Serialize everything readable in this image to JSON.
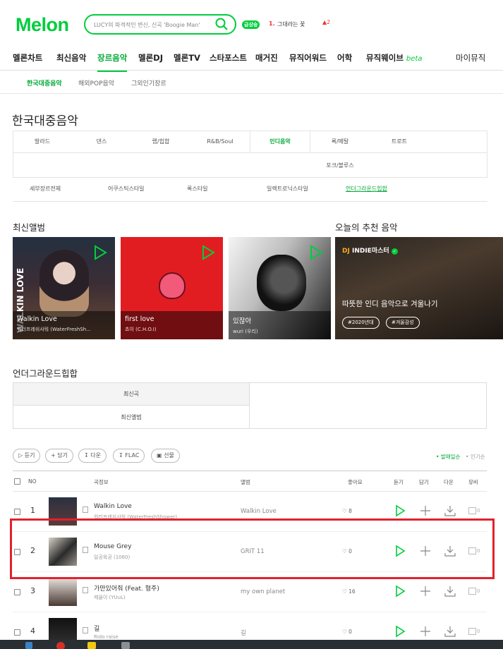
{
  "header": {
    "logo": "Melon",
    "search_placeholder": "LUCY의 파격적인 변신, 신곡 'Boogie Man'",
    "realtime": {
      "badge": "급상승",
      "rank": "1.",
      "title": "그대라는 꽃",
      "change": "2"
    }
  },
  "gnb": [
    {
      "label": "멜론차트"
    },
    {
      "label": "최신음악"
    },
    {
      "label": "장르음악"
    },
    {
      "label": "멜론DJ"
    },
    {
      "label": "멜론TV"
    },
    {
      "label": "스타포스트"
    },
    {
      "label": "매거진"
    },
    {
      "label": "뮤직어워드"
    },
    {
      "label": "어학"
    },
    {
      "label": "뮤직웨이브",
      "badge": "beta"
    },
    {
      "label": "마이뮤직"
    }
  ],
  "subnav": [
    {
      "label": "한국대중음악"
    },
    {
      "label": "해외POP음악"
    },
    {
      "label": "그외인기장르"
    }
  ],
  "page_title": "한국대중음악",
  "genre_tabs": [
    {
      "label": "발라드"
    },
    {
      "label": "댄스"
    },
    {
      "label": "랩/힙합"
    },
    {
      "label": "R&B/Soul"
    },
    {
      "label": "인디음악"
    },
    {
      "label": "록/메탈"
    },
    {
      "label": "트로트"
    },
    {
      "label": "포크/블루스"
    }
  ],
  "sub_genres": [
    {
      "label": "세부장르전체"
    },
    {
      "label": "어쿠스틱스타일"
    },
    {
      "label": "록스타일"
    },
    {
      "label": "일렉트로닉스타일"
    },
    {
      "label": "언더그라운드힙합"
    }
  ],
  "latest_albums_title": "최신앨범",
  "albums": [
    {
      "title": "Walkin Love",
      "artist": "워터프레쉬샤워 (WaterFreshSh...",
      "cover_text": "WALKIN LOVE"
    },
    {
      "title": "first love",
      "artist": "쵸이 (C.H.O.I)"
    },
    {
      "title": "있잖아",
      "artist": "wuri (우리)"
    }
  ],
  "recommend": {
    "title": "오늘의 추천 음악",
    "dj_prefix": "DJ",
    "dj_name": "INDIE마스터",
    "text": "따뜻한 인디 음악으로 겨울나기",
    "tags": [
      "#2020년대",
      "#겨울감성"
    ]
  },
  "underground": {
    "title": "언더그라운드힙합",
    "tabs": [
      "최신곡",
      "최신앨범"
    ]
  },
  "actions": [
    "듣기",
    "담기",
    "다운",
    "FLAC",
    "선물"
  ],
  "sort": {
    "popular": "발매일순",
    "alt": "인기순"
  },
  "table": {
    "headers": {
      "no": "NO",
      "song": "곡정보",
      "album": "앨범",
      "like": "좋아요",
      "listen": "듣기",
      "add": "담기",
      "down": "다운",
      "mv": "뮤비"
    },
    "rows": [
      {
        "no": "1",
        "title": "Walkin Love",
        "artist": "워터프레쉬샤워 (WaterFreshShower)",
        "album": "Walkin Love",
        "likes": "8",
        "mv": "0"
      },
      {
        "no": "2",
        "title": "Mouse Grey",
        "artist": "일공육공 (1060)",
        "album": "GRIT 11",
        "likes": "0",
        "mv": "0"
      },
      {
        "no": "3",
        "title": "가만있어줘 (Feat. 형주)",
        "artist": "제율이 (YUuL)",
        "album": "my own planet",
        "likes": "16",
        "mv": "0"
      },
      {
        "no": "4",
        "title": "길",
        "artist": "Rido raise",
        "album": "길",
        "likes": "0",
        "mv": "0"
      }
    ]
  },
  "colors": {
    "accent": "#00cd3c",
    "highlight": "#e2212d"
  }
}
